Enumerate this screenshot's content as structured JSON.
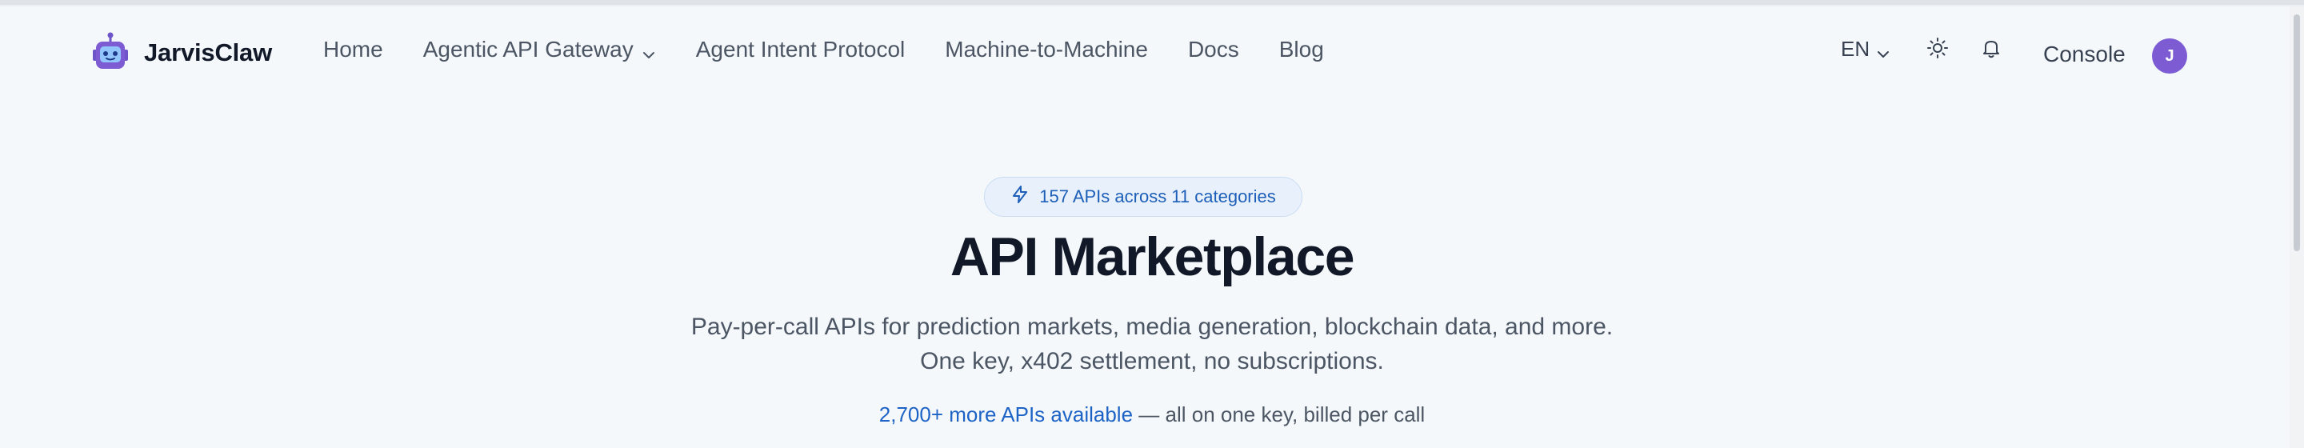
{
  "header": {
    "brand": "JarvisClaw",
    "nav": [
      {
        "label": "Home"
      },
      {
        "label": "Agentic API Gateway",
        "has_dropdown": true
      },
      {
        "label": "Agent Intent Protocol"
      },
      {
        "label": "Machine-to-Machine"
      },
      {
        "label": "Docs"
      },
      {
        "label": "Blog"
      }
    ],
    "language": "EN",
    "console_label": "Console",
    "avatar_initial": "J",
    "icons": [
      "robot-logo-icon",
      "chevron-down-icon",
      "sun-icon",
      "bell-icon"
    ]
  },
  "hero": {
    "badge_text": "157 APIs across 11 categories",
    "title": "API Marketplace",
    "subtitle_line1": "Pay-per-call APIs for prediction markets, media generation, blockchain data, and more.",
    "subtitle_line2": "One key, x402 settlement, no subscriptions.",
    "more_link": "2,700+ more APIs available",
    "more_suffix": " — all on one key, billed per call"
  },
  "colors": {
    "background": "#f4f8fb",
    "accent_blue": "#1d63c6",
    "avatar_purple": "#7c5bd3",
    "badge_bg": "#e8f1fb"
  }
}
